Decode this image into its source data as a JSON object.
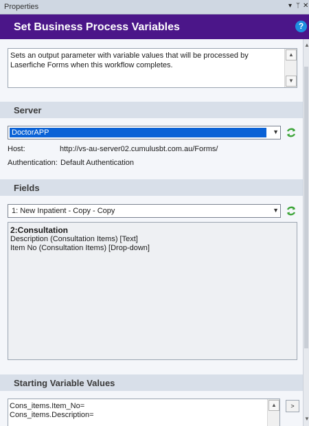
{
  "panel": {
    "title": "Properties",
    "btn_dropdown": "▾",
    "btn_pin": "ᛘ",
    "btn_close": "✕"
  },
  "header": {
    "title": "Set Business Process Variables",
    "help": "?"
  },
  "description": "Sets an output parameter with variable values that will be processed by Laserfiche Forms when this workflow completes.",
  "server": {
    "section_label": "Server",
    "selected": "DoctorAPP",
    "host_label": "Host:",
    "host_value": "http://vs-au-server02.cumulusbt.com.au/Forms/",
    "auth_label": "Authentication:",
    "auth_value": "Default Authentication"
  },
  "fields": {
    "section_label": "Fields",
    "selected_form": "1: New Inpatient - Copy - Copy",
    "group": "2:Consultation",
    "items": [
      "Description (Consultation Items) [Text]",
      "Item No (Consultation Items) [Drop-down]"
    ]
  },
  "starting_values": {
    "section_label": "Starting Variable Values",
    "lines": [
      "Cons_items.Item_No=",
      "Cons_items.Description="
    ],
    "button": ">"
  },
  "colors": {
    "header_bg": "#4b1689",
    "selection": "#0a62d6",
    "refresh": "#3ea53a"
  }
}
